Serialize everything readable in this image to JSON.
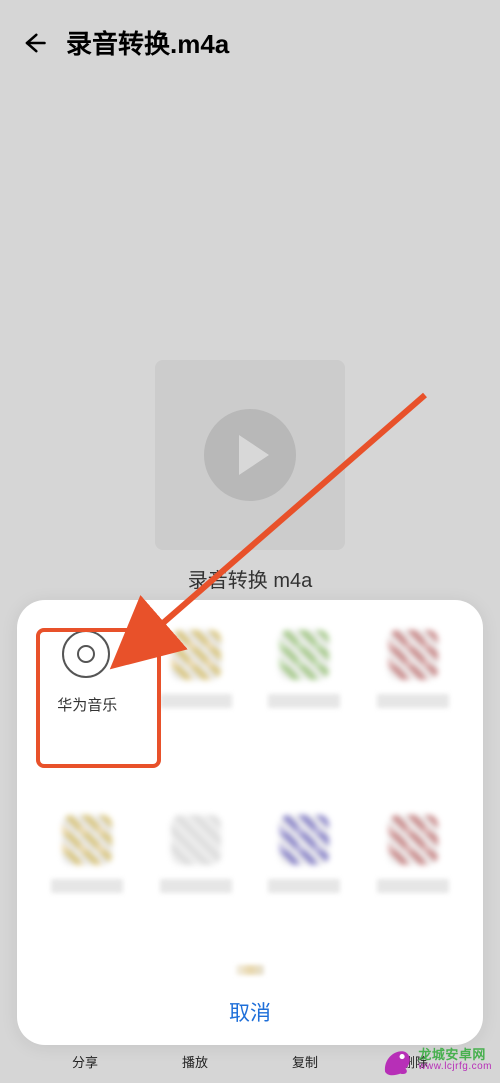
{
  "header": {
    "title": "录音转换.m4a"
  },
  "media": {
    "filename": "录音转换 m4a"
  },
  "share_sheet": {
    "apps": [
      {
        "label": "华为音乐",
        "icon": "disc"
      },
      {
        "label": "",
        "icon": "mosaic"
      },
      {
        "label": "",
        "icon": "mosaic"
      },
      {
        "label": "",
        "icon": "mosaic"
      },
      {
        "label": "",
        "icon": "mosaic"
      },
      {
        "label": "",
        "icon": "mosaic"
      },
      {
        "label": "",
        "icon": "mosaic"
      },
      {
        "label": "",
        "icon": "mosaic"
      }
    ],
    "cancel": "取消"
  },
  "bottom_tabs": [
    "分享",
    "播放",
    "复制",
    "删除"
  ],
  "watermark": {
    "line1": "龙城安卓网",
    "line2": "www.lcjrfg.com"
  }
}
